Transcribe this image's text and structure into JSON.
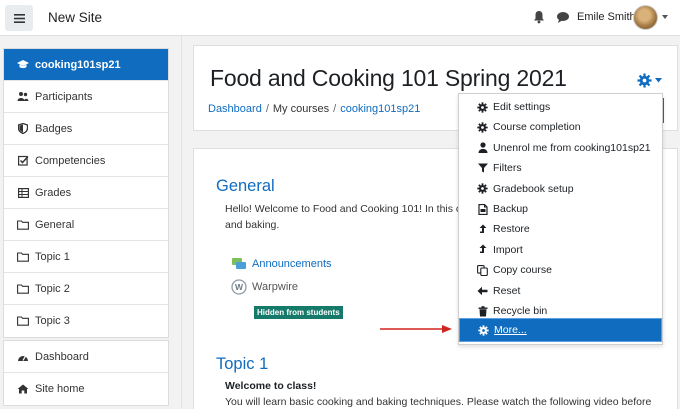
{
  "navbar": {
    "site_name": "New Site",
    "user_name": "Emile Smith"
  },
  "drawer": {
    "course_items": [
      {
        "label": "cooking101sp21",
        "icon": "graduation-cap-icon",
        "active": true
      },
      {
        "label": "Participants",
        "icon": "users-icon"
      },
      {
        "label": "Badges",
        "icon": "shield-icon"
      },
      {
        "label": "Competencies",
        "icon": "checkbox-icon"
      },
      {
        "label": "Grades",
        "icon": "table-icon"
      },
      {
        "label": "General",
        "icon": "folder-icon"
      },
      {
        "label": "Topic 1",
        "icon": "folder-icon"
      },
      {
        "label": "Topic 2",
        "icon": "folder-icon"
      },
      {
        "label": "Topic 3",
        "icon": "folder-icon"
      }
    ],
    "site_items": [
      {
        "label": "Dashboard",
        "icon": "dashboard-icon"
      },
      {
        "label": "Site home",
        "icon": "home-icon"
      }
    ]
  },
  "header": {
    "title": "Food and Cooking 101 Spring 2021",
    "breadcrumb": [
      "Dashboard",
      "My courses",
      "cooking101sp21"
    ]
  },
  "content": {
    "general_title": "General",
    "general_text_line1": "Hello! Welcome to Food and Cooking 101! In this co",
    "general_text_line2": "and baking.",
    "announcements": "Announcements",
    "warpwire": "Warpwire",
    "hidden_badge": "Hidden from students",
    "topic1_title": "Topic 1",
    "topic1_welcome": "Welcome to class!",
    "topic1_desc": "You will learn basic cooking and baking techniques. Please watch the following video before"
  },
  "dropdown": {
    "items": [
      {
        "label": "Edit settings",
        "icon": "gear-icon"
      },
      {
        "label": "Course completion",
        "icon": "gear-icon"
      },
      {
        "label": "Unenrol me from cooking101sp21",
        "icon": "user-icon"
      },
      {
        "label": "Filters",
        "icon": "filter-icon"
      },
      {
        "label": "Gradebook setup",
        "icon": "gear-icon"
      },
      {
        "label": "Backup",
        "icon": "file-icon"
      },
      {
        "label": "Restore",
        "icon": "upload-icon"
      },
      {
        "label": "Import",
        "icon": "upload-icon"
      },
      {
        "label": "Copy course",
        "icon": "copy-icon"
      },
      {
        "label": "Reset",
        "icon": "arrow-left-icon"
      },
      {
        "label": "Recycle bin",
        "icon": "trash-icon"
      },
      {
        "label": "More...",
        "icon": "gear-icon",
        "highlighted": true
      }
    ]
  },
  "colors": {
    "primary": "#0f6cbf",
    "badge": "#167a6b",
    "arrow": "#d0251f"
  }
}
